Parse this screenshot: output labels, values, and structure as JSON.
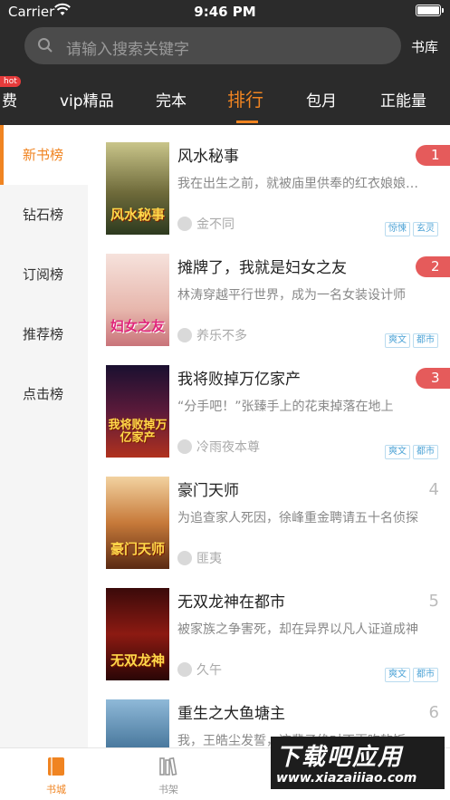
{
  "status_bar": {
    "carrier": "Carrier",
    "time": "9:46 PM"
  },
  "search": {
    "placeholder": "请输入搜索关键字",
    "library_label": "书库"
  },
  "tabs": [
    {
      "label": "费",
      "badge": "hot"
    },
    {
      "label": "vip精品"
    },
    {
      "label": "完本"
    },
    {
      "label": "排行",
      "active": true
    },
    {
      "label": "包月"
    },
    {
      "label": "正能量"
    }
  ],
  "sidebar": {
    "items": [
      {
        "label": "新书榜",
        "active": true
      },
      {
        "label": "钻石榜"
      },
      {
        "label": "订阅榜"
      },
      {
        "label": "推荐榜"
      },
      {
        "label": "点击榜"
      }
    ]
  },
  "books": [
    {
      "rank": "1",
      "title": "风水秘事",
      "desc": "我在出生之前，就被庙里供奉的红衣娘娘选中",
      "author": "金不同",
      "tags": [
        "惊悚",
        "玄灵"
      ],
      "cover_text": "风水秘事"
    },
    {
      "rank": "2",
      "title": "摊牌了，我就是妇女之友",
      "desc": "林涛穿越平行世界，成为一名女装设计师",
      "author": "养乐不多",
      "tags": [
        "爽文",
        "都市"
      ],
      "cover_text": "妇女之友"
    },
    {
      "rank": "3",
      "title": "我将败掉万亿家产",
      "desc": "“分手吧！”张臻手上的花束掉落在地上",
      "author": "冷雨夜本尊",
      "tags": [
        "爽文",
        "都市"
      ],
      "cover_text": "我将败掉万亿家产"
    },
    {
      "rank": "4",
      "title": "豪门天师",
      "desc": "为追查家人死因，徐峰重金聘请五十名侦探",
      "author": "匪夷",
      "tags": [],
      "cover_text": "豪门天师"
    },
    {
      "rank": "5",
      "title": "无双龙神在都市",
      "desc": "被家族之争害死，却在异界以凡人证道成神",
      "author": "久午",
      "tags": [
        "爽文",
        "都市"
      ],
      "cover_text": "无双龙神"
    },
    {
      "rank": "6",
      "title": "重生之大鱼塘主",
      "desc": "我，王皓尘发誓，这辈子绝对不再吃软饭",
      "author": "",
      "tags": [],
      "cover_text": ""
    }
  ],
  "bottom_nav": [
    {
      "label": "书城",
      "active": true
    },
    {
      "label": "书架"
    }
  ],
  "watermark": {
    "line1": "下载吧应用",
    "line2": "www.xiazaiiiao.com"
  },
  "colors": {
    "accent": "#f08421",
    "header_bg": "#2b2b2b",
    "rank_bg": "#e55b5b",
    "tag": "#4da3d6"
  }
}
